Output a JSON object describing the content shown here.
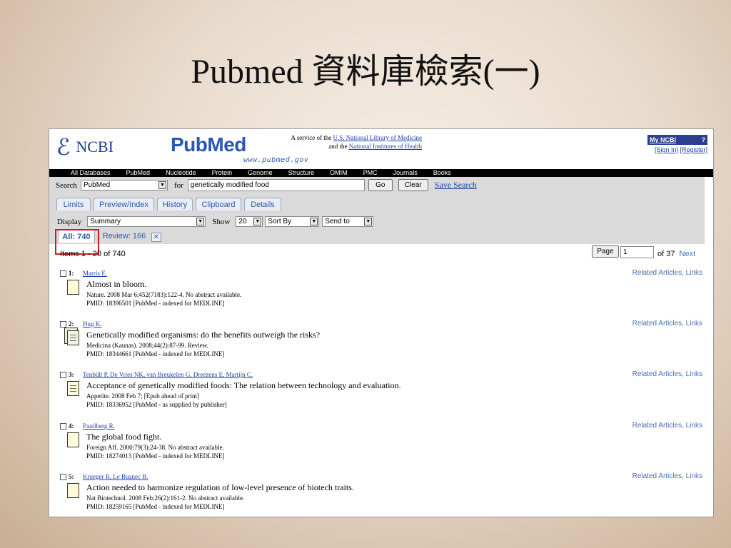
{
  "slide": {
    "title": "Pubmed 資料庫檢索(一)"
  },
  "header": {
    "ncbi_mark": "ℰ",
    "ncbi_text": "NCBI",
    "pubmed_pub": "Pub",
    "pubmed_med": "Med",
    "pubmed_url": "www.pubmed.gov",
    "service_prefix": "A service of the",
    "service_link1": "U.S. National Library of Medicine",
    "service_and": "and the",
    "service_link2": "National Institutes of Health",
    "my_ncbi": "My NCBI",
    "help_q": "?",
    "sign_in": "[Sign In]",
    "register": "[Register]"
  },
  "nav": [
    "All Databases",
    "PubMed",
    "Nucleotide",
    "Protein",
    "Genome",
    "Structure",
    "OMIM",
    "PMC",
    "Journals",
    "Books"
  ],
  "search": {
    "label": "Search",
    "database": "PubMed",
    "for_label": "for",
    "query": "genetically modified food",
    "go": "Go",
    "clear": "Clear",
    "save": "Save Search"
  },
  "tabs": [
    "Limits",
    "Preview/Index",
    "History",
    "Clipboard",
    "Details"
  ],
  "display": {
    "label": "Display",
    "format": "Summary",
    "show_label": "Show",
    "show_value": "20",
    "sort": "Sort By",
    "send": "Send to"
  },
  "result_tabs": {
    "all": "All: 740",
    "review": "Review: 166"
  },
  "paging": {
    "items": "Items 1 - 20 of 740",
    "page_button": "Page",
    "page_value": "1",
    "of_pages": "of 37",
    "next": "Next"
  },
  "colors": {
    "highlight": "#d01c1c",
    "link": "#1f3fa8",
    "navbar": "#000000"
  },
  "results": [
    {
      "num": "1:",
      "authors": "Marris E.",
      "title": "Almost in bloom.",
      "citation": "Nature. 2008 Mar 6;452(7183):122-4. No abstract available.",
      "pmid": "PMID: 18396501 [PubMed - indexed for MEDLINE]",
      "icon": "document-icon",
      "related": "Related Articles",
      "sep": ",",
      "links": "Links"
    },
    {
      "num": "2:",
      "authors": "Hug K.",
      "title": "Genetically modified organisms: do the benefits outweigh the risks?",
      "citation": "Medicina (Kaunas). 2008;44(2):87-99. Review.",
      "pmid": "PMID: 18344661 [PubMed - indexed for MEDLINE]",
      "icon": "review-document-icon",
      "related": "Related Articles",
      "sep": ",",
      "links": "Links"
    },
    {
      "num": "3:",
      "authors": "Tenbült P, De Vries NK, van Breukelen G, Dreezens E, Martijn C.",
      "title": "Acceptance of genetically modified foods: The relation between technology and evaluation.",
      "citation": "Appetite. 2008 Feb 7; [Epub ahead of print]",
      "pmid": "PMID: 18336952 [PubMed - as supplied by publisher]",
      "icon": "abstract-document-icon",
      "related": "Related Articles",
      "sep": ",",
      "links": "Links"
    },
    {
      "num": "4:",
      "authors": "Paarlberg R.",
      "title": "The global food fight.",
      "citation": "Foreign Aff. 2000;79(3):24-38. No abstract available.",
      "pmid": "PMID: 18274013 [PubMed - indexed for MEDLINE]",
      "icon": "document-icon",
      "related": "Related Articles",
      "sep": ",",
      "links": "Links"
    },
    {
      "num": "5:",
      "authors": "Krueger R, Le Buanec B.",
      "title": "Action needed to harmonize regulation of low-level presence of biotech traits.",
      "citation": "Nat Biotechnol. 2008 Feb;26(2):161-2. No abstract available.",
      "pmid": "PMID: 18259165 [PubMed - indexed for MEDLINE]",
      "icon": "document-icon",
      "related": "Related Articles",
      "sep": ",",
      "links": "Links"
    }
  ]
}
